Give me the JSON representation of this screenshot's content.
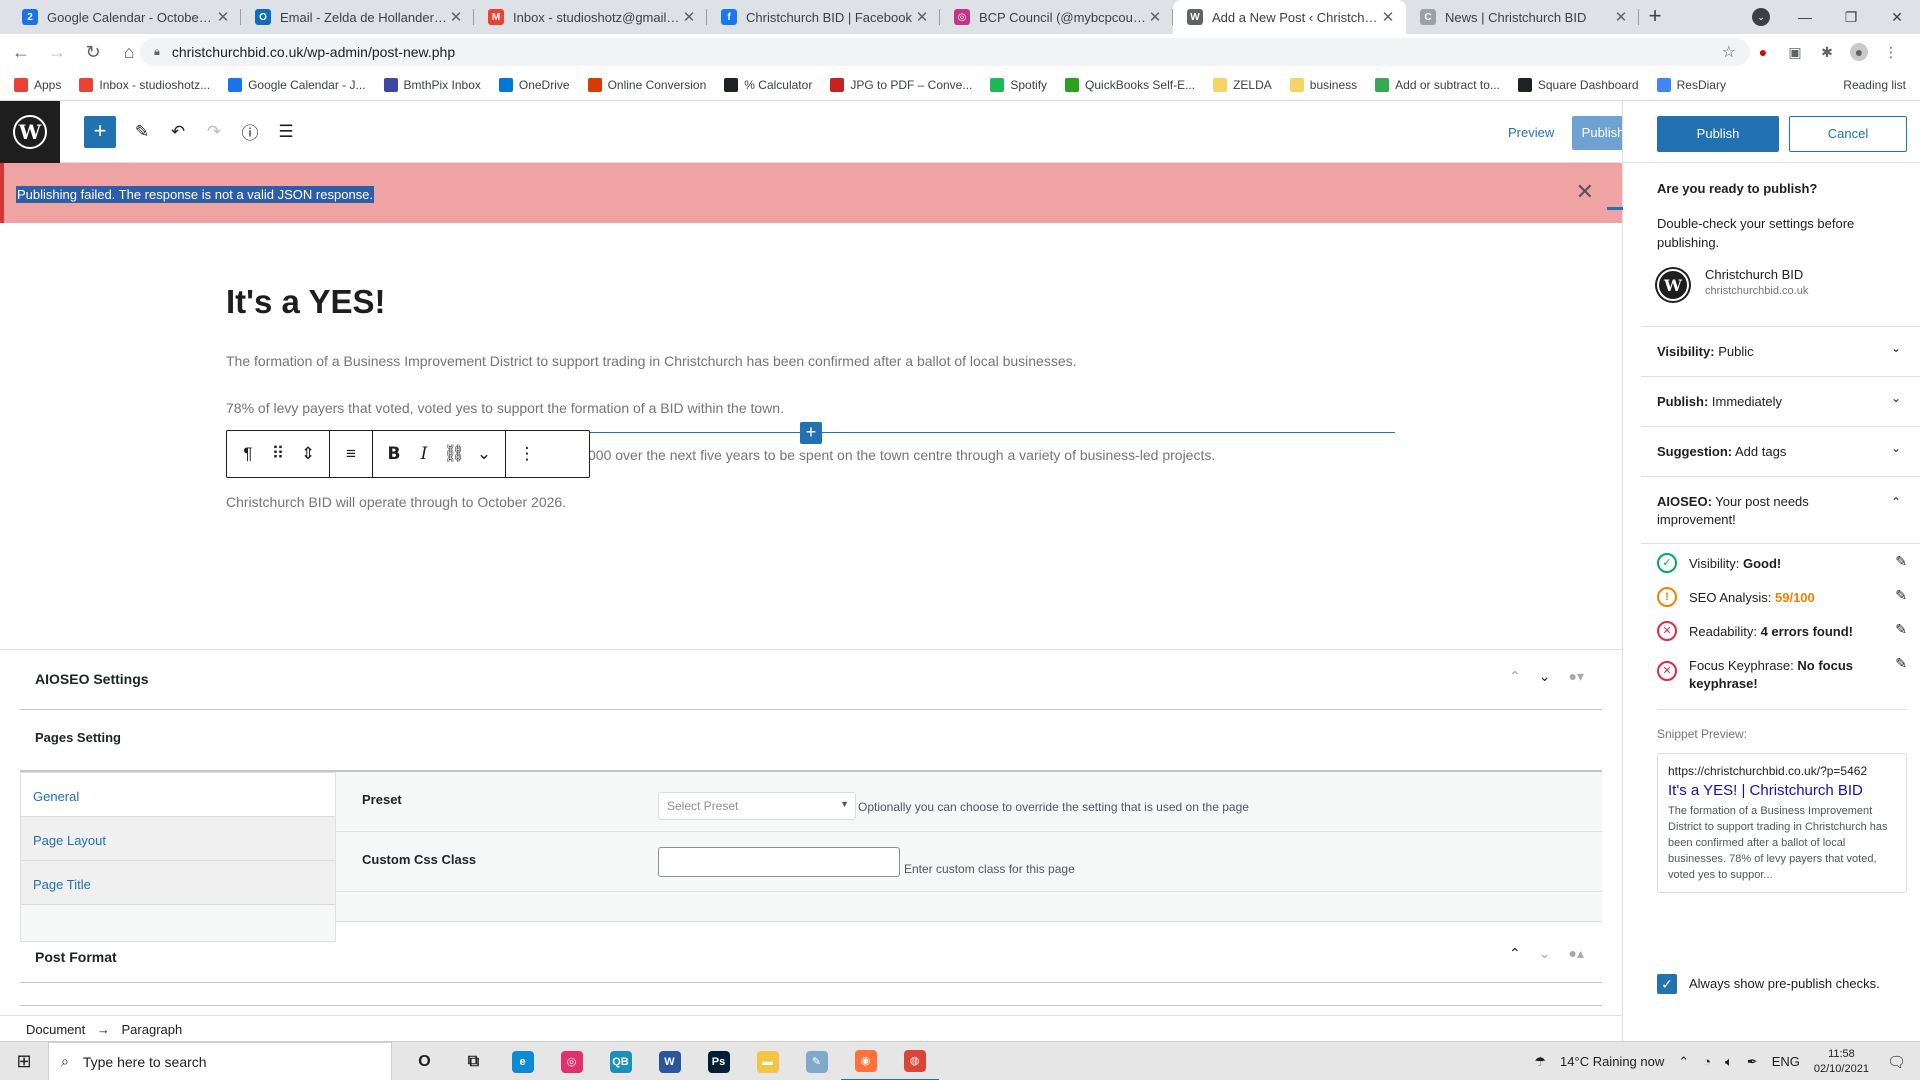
{
  "browser": {
    "tabs": [
      {
        "title": "Google Calendar - October 2021",
        "icon": "calendar-icon",
        "color": "#1a73e8",
        "glyph": "2"
      },
      {
        "title": "Email - Zelda de Hollander - Out",
        "icon": "outlook-icon",
        "color": "#0f6cbd",
        "glyph": "O"
      },
      {
        "title": "Inbox - studioshotz@gmail.com",
        "icon": "gmail-icon",
        "color": "#ea4335",
        "glyph": "M"
      },
      {
        "title": "Christchurch BID | Facebook",
        "icon": "facebook-icon",
        "color": "#1877f2",
        "glyph": "f"
      },
      {
        "title": "BCP Council (@mybcpcouncil) •",
        "icon": "instagram-icon",
        "color": "#c13584",
        "glyph": "◎"
      },
      {
        "title": "Add a New Post ‹ Christchurch B",
        "icon": "wordpress-icon",
        "color": "#5f6368",
        "glyph": "W"
      },
      {
        "title": "News | Christchurch BID",
        "icon": "loading-icon",
        "color": "#9aa0a6",
        "glyph": "C"
      }
    ],
    "active_tab": 5,
    "new_tab": "+",
    "url": "christchurchbid.co.uk/wp-admin/post-new.php",
    "bookmarks": [
      {
        "label": "Apps",
        "icon": "apps-grid-icon",
        "color": "#ea4335"
      },
      {
        "label": "Inbox - studioshotz...",
        "icon": "gmail-icon",
        "color": "#ea4335"
      },
      {
        "label": "Google Calendar - J...",
        "icon": "calendar-icon",
        "color": "#1a73e8"
      },
      {
        "label": "BmthPix Inbox",
        "icon": "bmthpix-icon",
        "color": "#3b4aa0"
      },
      {
        "label": "OneDrive",
        "icon": "onedrive-icon",
        "color": "#0078d4"
      },
      {
        "label": "Online Conversion",
        "icon": "conversion-icon",
        "color": "#d83b01"
      },
      {
        "label": "% Calculator",
        "icon": "percent-icon",
        "color": "#202124"
      },
      {
        "label": "JPG to PDF – Conve...",
        "icon": "jpg-pdf-icon",
        "color": "#c5221f"
      },
      {
        "label": "Spotify",
        "icon": "spotify-icon",
        "color": "#1db954"
      },
      {
        "label": "QuickBooks Self-E...",
        "icon": "quickbooks-icon",
        "color": "#2ca01c"
      },
      {
        "label": "ZELDA",
        "icon": "folder-icon",
        "color": "#f6d365"
      },
      {
        "label": "business",
        "icon": "folder-icon",
        "color": "#f6d365"
      },
      {
        "label": "Add or subtract to...",
        "icon": "calc-dots-icon",
        "color": "#34a853"
      },
      {
        "label": "Square Dashboard",
        "icon": "square-icon",
        "color": "#202124"
      },
      {
        "label": "ResDiary",
        "icon": "resdiary-icon",
        "color": "#4285f4"
      }
    ],
    "reading_list": "Reading list"
  },
  "editor": {
    "preview_label": "Preview",
    "publish_label": "Publish",
    "notice": "Publishing failed. The response is not a valid JSON response.",
    "title": "It's a YES!",
    "paragraphs": [
      "The formation of a Business Improvement District to support trading in Christchurch has been confirmed after a ballot of local businesses.",
      "78% of levy payers that voted, voted yes to support the formation of a BID within the town.",
      "000 over the next five years to be spent on the town centre through a variety of business-led projects.",
      "Christchurch BID will operate through to October 2026."
    ],
    "breadcrumb": [
      "Document",
      "→",
      "Paragraph"
    ]
  },
  "metaboxes": {
    "aioseo_title": "AIOSEO Settings",
    "pages_setting_title": "Pages Setting",
    "tabs": [
      "General",
      "Page Layout",
      "Page Title"
    ],
    "preset_label": "Preset",
    "preset_placeholder": "Select Preset",
    "preset_hint": "Optionally you can choose to override the setting that is used on the page",
    "css_label": "Custom Css Class",
    "css_hint": "Enter custom class for this page",
    "post_format_title": "Post Format"
  },
  "sidebar": {
    "publish_label": "Publish",
    "cancel_label": "Cancel",
    "heading": "Are you ready to publish?",
    "intro": "Double-check your settings before publishing.",
    "site_name": "Christchurch BID",
    "site_url": "christchurchbid.co.uk",
    "panels": [
      {
        "label": "Visibility:",
        "value": "Public",
        "chevron": "⌄"
      },
      {
        "label": "Publish:",
        "value": "Immediately",
        "chevron": "⌄"
      },
      {
        "label": "Suggestion:",
        "value": "Add tags",
        "chevron": "⌄"
      },
      {
        "label": "AIOSEO:",
        "value": "Your post needs improvement!",
        "chevron": "⌃"
      }
    ],
    "checks": [
      {
        "label": "Visibility:",
        "value": "Good!",
        "status": "good"
      },
      {
        "label": "SEO Analysis:",
        "value": "59/100",
        "status": "warn"
      },
      {
        "label": "Readability:",
        "value": "4 errors found!",
        "status": "bad"
      },
      {
        "label": "Focus Keyphrase:",
        "value": "No focus keyphrase!",
        "status": "bad"
      }
    ],
    "snippet_label": "Snippet Preview:",
    "snippet_url": "https://christchurchbid.co.uk/?p=5462",
    "snippet_title": "It's a YES! | Christchurch BID",
    "snippet_desc": "The formation of a Business Improvement District to support trading in Christchurch has been confirmed after a ballot of local businesses. 78% of levy payers that voted, voted yes to suppor...",
    "always_show": "Always show pre-publish checks."
  },
  "taskbar": {
    "search_placeholder": "Type here to search",
    "apps": [
      {
        "icon": "cortana-icon",
        "color": "#1e1e1e",
        "glyph": "O"
      },
      {
        "icon": "task-view-icon",
        "color": "#1e1e1e",
        "glyph": "⧉"
      },
      {
        "icon": "edge-icon",
        "color": "#0c8ad6",
        "glyph": "e"
      },
      {
        "icon": "instagram-icon",
        "color": "#e1306c",
        "glyph": "◎"
      },
      {
        "icon": "quickbooks-icon",
        "color": "#1b8fbc",
        "glyph": "QB"
      },
      {
        "icon": "word-icon",
        "color": "#2b579a",
        "glyph": "W"
      },
      {
        "icon": "photoshop-icon",
        "color": "#001e36",
        "glyph": "Ps"
      },
      {
        "icon": "file-explorer-icon",
        "color": "#f4c542",
        "glyph": "▬"
      },
      {
        "icon": "notepad-icon",
        "color": "#7fa9c9",
        "glyph": "✎"
      },
      {
        "icon": "firefox-icon",
        "color": "#ff7139",
        "glyph": "◉"
      },
      {
        "icon": "chrome-icon",
        "color": "#db4437",
        "glyph": "◍"
      }
    ],
    "weather": "14°C  Raining now",
    "language": "ENG",
    "time": "11:58",
    "date": "02/10/2021"
  }
}
